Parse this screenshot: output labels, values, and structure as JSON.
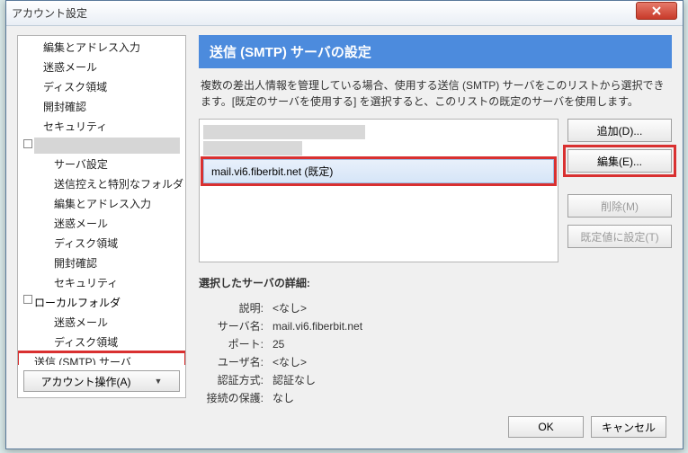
{
  "window": {
    "title": "アカウント設定"
  },
  "sidebar": {
    "items": [
      "編集とアドレス入力",
      "迷惑メール",
      "ディスク領域",
      "開封確認",
      "セキュリティ"
    ],
    "acct_children": [
      "サーバ設定",
      "送信控えと特別なフォルダ",
      "編集とアドレス入力",
      "迷惑メール",
      "ディスク領域",
      "開封確認",
      "セキュリティ"
    ],
    "local_label": "ローカルフォルダ",
    "local_children": [
      "迷惑メール",
      "ディスク領域"
    ],
    "smtp_label": "送信 (SMTP) サーバ",
    "account_ops": "アカウント操作(A)"
  },
  "main": {
    "header": "送信 (SMTP) サーバの設定",
    "desc": "複数の差出人情報を管理している場合、使用する送信 (SMTP) サーバをこのリストから選択できます。[既定のサーバを使用する] を選択すると、このリストの既定のサーバを使用します。",
    "server_row": "mail.vi6.fiberbit.net (既定)",
    "buttons": {
      "add": "追加(D)...",
      "edit": "編集(E)...",
      "remove": "削除(M)",
      "setdefault": "既定値に設定(T)"
    },
    "details_title": "選択したサーバの詳細:",
    "details": {
      "desc_k": "説明:",
      "desc_v": "<なし>",
      "server_k": "サーバ名:",
      "server_v": "mail.vi6.fiberbit.net",
      "port_k": "ポート:",
      "port_v": "25",
      "user_k": "ユーザ名:",
      "user_v": "<なし>",
      "auth_k": "認証方式:",
      "auth_v": "認証なし",
      "sec_k": "接続の保護:",
      "sec_v": "なし"
    }
  },
  "footer": {
    "ok": "OK",
    "cancel": "キャンセル"
  }
}
